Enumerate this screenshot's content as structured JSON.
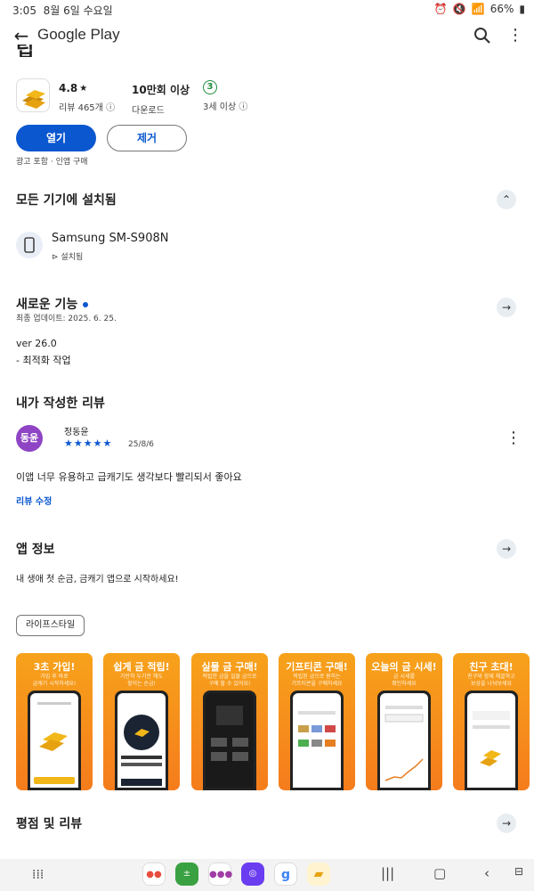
{
  "status": {
    "time": "3:05",
    "date": "8월 6일 수요일",
    "battery": "66%"
  },
  "appbar": {
    "title": "Google Play",
    "back_icon": "←",
    "more_icon": "⋮"
  },
  "app": {
    "title_fragment": "립",
    "rating": "4.8",
    "rating_star": "★",
    "reviews_label": "리뷰 465개",
    "downloads": "10만회 이상",
    "downloads_label": "다운로드",
    "age_badge": "3",
    "age_label": "3세 이상",
    "open_label": "열기",
    "remove_label": "제거",
    "ads_note": "광고 포함 · 인앱 구매"
  },
  "installed": {
    "heading": "모든 기기에 설치됨",
    "device_name": "Samsung SM-S908N",
    "device_status": "설치됨"
  },
  "whats_new": {
    "heading": "새로운 기능",
    "updated": "최종 업데이트: 2025. 6. 25.",
    "version": "ver 26.0",
    "note": "- 최적화 작업"
  },
  "my_review": {
    "heading": "내가 작성한 리뷰",
    "avatar": "동윤",
    "name": "정동윤",
    "stars": "★★★★★",
    "date": "25/8/6",
    "text": "이앱 너무 유용하고 급캐기도 생각보다 빨리되서 좋아요",
    "edit_label": "리뷰 수정"
  },
  "app_info": {
    "heading": "앱 정보",
    "description": "내 생애 첫 순금, 금캐기 앱으로 시작하세요!",
    "category_chip": "라이프스타일"
  },
  "screenshots": [
    {
      "title": "3초 가입!",
      "sub": "가입 후 바로\n금캐기 시작하세요!"
    },
    {
      "title": "쉽게 금 적립!",
      "sub": "가만히 두기만 해도\n쌓이는 순금!"
    },
    {
      "title": "실물 금 구매!",
      "sub": "적립한 금을 실물 금으로\n구매 할 수 있어요!"
    },
    {
      "title": "기프티콘 구매!",
      "sub": "적립된 금으로 원하는\n기프티콘을 구매하세요"
    },
    {
      "title": "오늘의 금 시세!",
      "sub": "금 시세를\n확인하세요"
    },
    {
      "title": "친구 초대!",
      "sub": "친구와 함께 채굴하고\n보상을 나눠보세요"
    }
  ],
  "ratings": {
    "heading": "평점 및 리뷰"
  },
  "colors": {
    "accent": "#0b57d0",
    "shot_bg": "#f7941d",
    "avatar": "#8e44c4",
    "age_green": "#1e8e3e"
  }
}
